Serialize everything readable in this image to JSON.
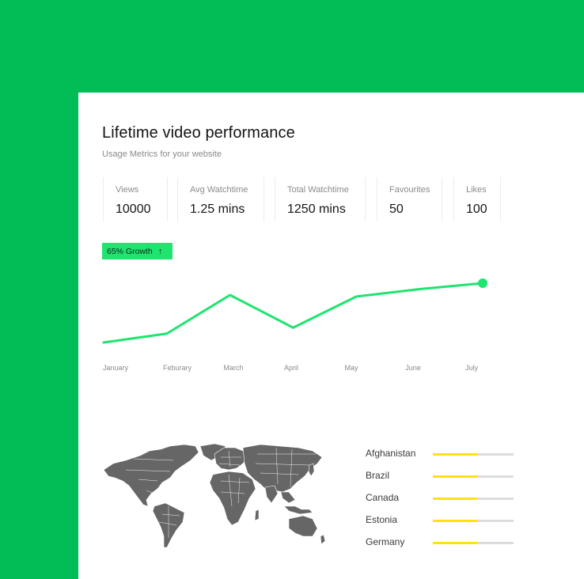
{
  "card": {
    "title": "Lifetime video performance",
    "subtitle": "Usage Metrics for your website"
  },
  "metrics": [
    {
      "label": "Views",
      "value": "10000"
    },
    {
      "label": "Avg Watchtime",
      "value": "1.25 mins"
    },
    {
      "label": "Total Watchtime",
      "value": "1250 mins"
    },
    {
      "label": "Favourites",
      "value": "50"
    },
    {
      "label": "Likes",
      "value": "100"
    }
  ],
  "growth_badge": {
    "label": "65% Growth",
    "icon": "arrow-up-icon"
  },
  "colors": {
    "background": "#02bd56",
    "accent_line": "#1fe470",
    "bar_fill": "#ffe20a",
    "map": "#666666"
  },
  "chart_data": {
    "type": "line",
    "categories": [
      "January",
      "Feburary",
      "March",
      "April",
      "May",
      "June",
      "July"
    ],
    "values": [
      1,
      1.6,
      4.2,
      2,
      4.1,
      4.6,
      5
    ]
  },
  "countries": [
    {
      "name": "Afghanistan",
      "value": 0.55
    },
    {
      "name": "Brazil",
      "value": 0.55
    },
    {
      "name": "Canada",
      "value": 0.55
    },
    {
      "name": "Estonia",
      "value": 0.55
    },
    {
      "name": "Germany",
      "value": 0.55
    }
  ]
}
